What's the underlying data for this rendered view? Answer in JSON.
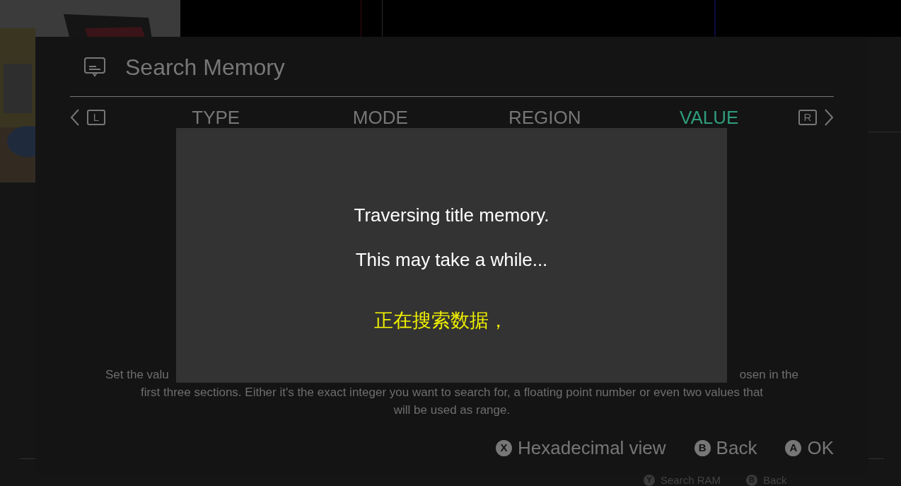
{
  "panel": {
    "title": "Search Memory",
    "tabs": [
      {
        "label": "TYPE",
        "selected": false
      },
      {
        "label": "MODE",
        "selected": false
      },
      {
        "label": "REGION",
        "selected": false
      },
      {
        "label": "VALUE",
        "selected": true
      }
    ],
    "prev_key": "L",
    "next_key": "R",
    "description": {
      "line_1_start": "Set the valu",
      "line_1_end": "osen in the",
      "line_2": "first three sections. Either it's the exact integer you want to search for, a floating point number or even two values that",
      "line_3": "will be used as range."
    },
    "actions": [
      {
        "key": "X",
        "label": "Hexadecimal view"
      },
      {
        "key": "B",
        "label": "Back"
      },
      {
        "key": "A",
        "label": "OK"
      }
    ]
  },
  "dialog": {
    "lines": [
      "Traversing title memory.",
      "This may take a while..."
    ],
    "note": "正在搜索数据，"
  },
  "background_actions": [
    {
      "key": "Y",
      "label": "Search RAM"
    },
    {
      "key": "B",
      "label": "Back"
    }
  ]
}
